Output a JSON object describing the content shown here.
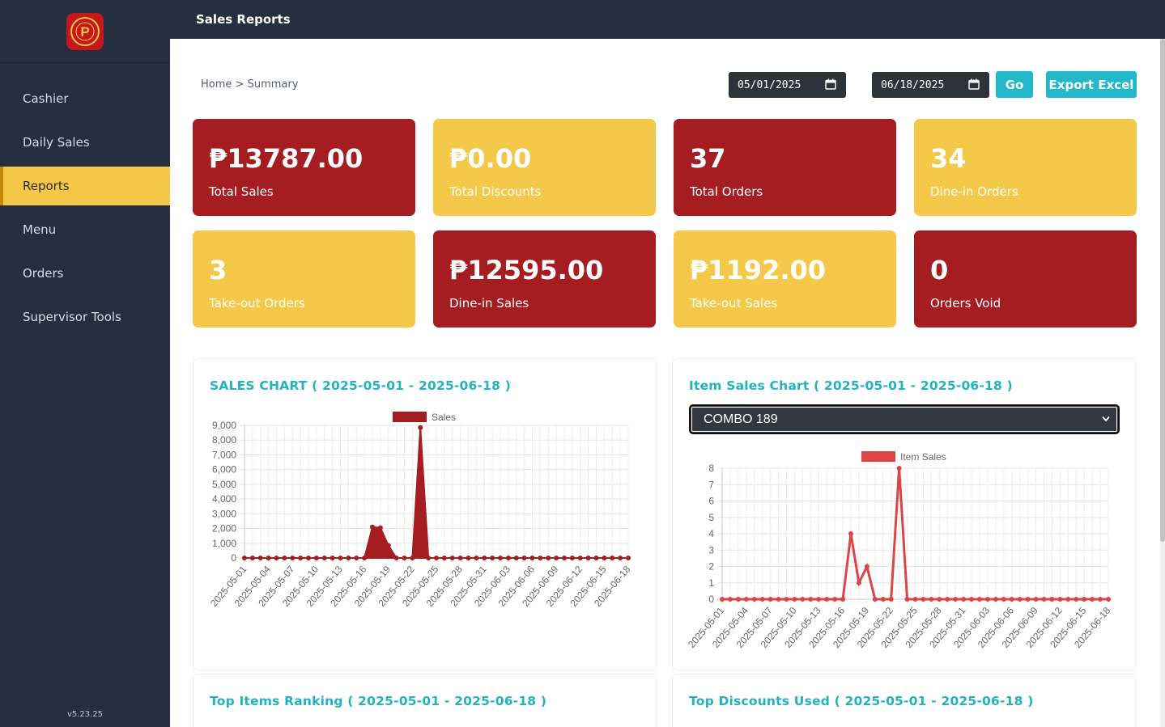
{
  "app": {
    "title": "Sales Reports",
    "version": "v5.23.25"
  },
  "sidebar": {
    "items": [
      {
        "label": "Cashier"
      },
      {
        "label": "Daily Sales"
      },
      {
        "label": "Reports"
      },
      {
        "label": "Menu"
      },
      {
        "label": "Orders"
      },
      {
        "label": "Supervisor Tools"
      }
    ],
    "active": "Reports",
    "logo_letter": "P"
  },
  "breadcrumb": {
    "home": "Home",
    "separator": ">",
    "current": "Summary"
  },
  "filters": {
    "start_date": "05/01/2025",
    "end_date": "06/18/2025",
    "go_label": "Go",
    "export_label": "Export Excel"
  },
  "cards": [
    {
      "value": "₱13787.00",
      "label": "Total Sales"
    },
    {
      "value": "₱0.00",
      "label": "Total Discounts"
    },
    {
      "value": "37",
      "label": "Total Orders"
    },
    {
      "value": "34",
      "label": "Dine-in Orders"
    },
    {
      "value": "3",
      "label": "Take-out Orders"
    },
    {
      "value": "₱12595.00",
      "label": "Dine-in Sales"
    },
    {
      "value": "₱1192.00",
      "label": "Take-out Sales"
    },
    {
      "value": "0",
      "label": "Orders Void"
    }
  ],
  "panels": {
    "sales_chart_title": "SALES CHART ( 2025-05-01 - 2025-06-18 )",
    "item_chart_title": "Item Sales Chart ( 2025-05-01 - 2025-06-18 )",
    "item_select_value": "COMBO 189",
    "top_items_title": "Top Items Ranking ( 2025-05-01 - 2025-06-18 )",
    "top_discounts_title": "Top Discounts Used ( 2025-05-01 - 2025-06-18 )"
  },
  "colors": {
    "sidebar": "#252f3f",
    "accent_yellow": "#f4c848",
    "accent_red": "#a51c21",
    "teal": "#22b8c9",
    "item_line": "#dc4545"
  },
  "chart_data": [
    {
      "type": "area",
      "legend": [
        "Sales"
      ],
      "legend_position": "top",
      "ylim": [
        0,
        9000
      ],
      "yticks": [
        "0",
        "1,000",
        "2,000",
        "3,000",
        "4,000",
        "5,000",
        "6,000",
        "7,000",
        "8,000",
        "9,000"
      ],
      "x": [
        "2025-05-01",
        "2025-05-02",
        "2025-05-03",
        "2025-05-04",
        "2025-05-05",
        "2025-05-06",
        "2025-05-07",
        "2025-05-08",
        "2025-05-09",
        "2025-05-10",
        "2025-05-11",
        "2025-05-12",
        "2025-05-13",
        "2025-05-14",
        "2025-05-15",
        "2025-05-16",
        "2025-05-17",
        "2025-05-18",
        "2025-05-19",
        "2025-05-20",
        "2025-05-21",
        "2025-05-22",
        "2025-05-23",
        "2025-05-24",
        "2025-05-25",
        "2025-05-26",
        "2025-05-27",
        "2025-05-28",
        "2025-05-29",
        "2025-05-30",
        "2025-05-31",
        "2025-06-01",
        "2025-06-02",
        "2025-06-03",
        "2025-06-04",
        "2025-06-05",
        "2025-06-06",
        "2025-06-07",
        "2025-06-08",
        "2025-06-09",
        "2025-06-10",
        "2025-06-11",
        "2025-06-12",
        "2025-06-13",
        "2025-06-14",
        "2025-06-15",
        "2025-06-16",
        "2025-06-17",
        "2025-06-18"
      ],
      "xtick_labels": [
        "2025-05-01",
        "2025-05-04",
        "2025-05-07",
        "2025-05-10",
        "2025-05-13",
        "2025-05-16",
        "2025-05-19",
        "2025-05-22",
        "2025-05-25",
        "2025-05-28",
        "2025-05-31",
        "2025-06-03",
        "2025-06-06",
        "2025-06-09",
        "2025-06-12",
        "2025-06-15",
        "2025-06-18"
      ],
      "series": [
        {
          "name": "Sales",
          "values": [
            0,
            0,
            0,
            0,
            0,
            0,
            0,
            0,
            0,
            0,
            0,
            0,
            0,
            0,
            0,
            0,
            2100,
            2050,
            850,
            0,
            0,
            0,
            8850,
            0,
            0,
            0,
            0,
            0,
            0,
            0,
            0,
            0,
            0,
            0,
            0,
            0,
            0,
            0,
            0,
            0,
            0,
            0,
            0,
            0,
            0,
            0,
            0,
            0,
            0
          ]
        }
      ],
      "grid": true
    },
    {
      "type": "line",
      "legend": [
        "Item Sales"
      ],
      "legend_position": "top",
      "ylim": [
        0,
        8
      ],
      "yticks": [
        "0",
        "1",
        "2",
        "3",
        "4",
        "5",
        "6",
        "7",
        "8"
      ],
      "x": [
        "2025-05-01",
        "2025-05-02",
        "2025-05-03",
        "2025-05-04",
        "2025-05-05",
        "2025-05-06",
        "2025-05-07",
        "2025-05-08",
        "2025-05-09",
        "2025-05-10",
        "2025-05-11",
        "2025-05-12",
        "2025-05-13",
        "2025-05-14",
        "2025-05-15",
        "2025-05-16",
        "2025-05-17",
        "2025-05-18",
        "2025-05-19",
        "2025-05-20",
        "2025-05-21",
        "2025-05-22",
        "2025-05-23",
        "2025-05-24",
        "2025-05-25",
        "2025-05-26",
        "2025-05-27",
        "2025-05-28",
        "2025-05-29",
        "2025-05-30",
        "2025-05-31",
        "2025-06-01",
        "2025-06-02",
        "2025-06-03",
        "2025-06-04",
        "2025-06-05",
        "2025-06-06",
        "2025-06-07",
        "2025-06-08",
        "2025-06-09",
        "2025-06-10",
        "2025-06-11",
        "2025-06-12",
        "2025-06-13",
        "2025-06-14",
        "2025-06-15",
        "2025-06-16",
        "2025-06-17",
        "2025-06-18"
      ],
      "xtick_labels": [
        "2025-05-01",
        "2025-05-04",
        "2025-05-07",
        "2025-05-10",
        "2025-05-13",
        "2025-05-16",
        "2025-05-19",
        "2025-05-22",
        "2025-05-25",
        "2025-05-28",
        "2025-05-31",
        "2025-06-03",
        "2025-06-06",
        "2025-06-09",
        "2025-06-12",
        "2025-06-15",
        "2025-06-18"
      ],
      "series": [
        {
          "name": "Item Sales",
          "values": [
            0,
            0,
            0,
            0,
            0,
            0,
            0,
            0,
            0,
            0,
            0,
            0,
            0,
            0,
            0,
            0,
            4,
            1,
            2,
            0,
            0,
            0,
            8,
            0,
            0,
            0,
            0,
            0,
            0,
            0,
            0,
            0,
            0,
            0,
            0,
            0,
            0,
            0,
            0,
            0,
            0,
            0,
            0,
            0,
            0,
            0,
            0,
            0,
            0
          ]
        }
      ],
      "grid": true
    }
  ]
}
